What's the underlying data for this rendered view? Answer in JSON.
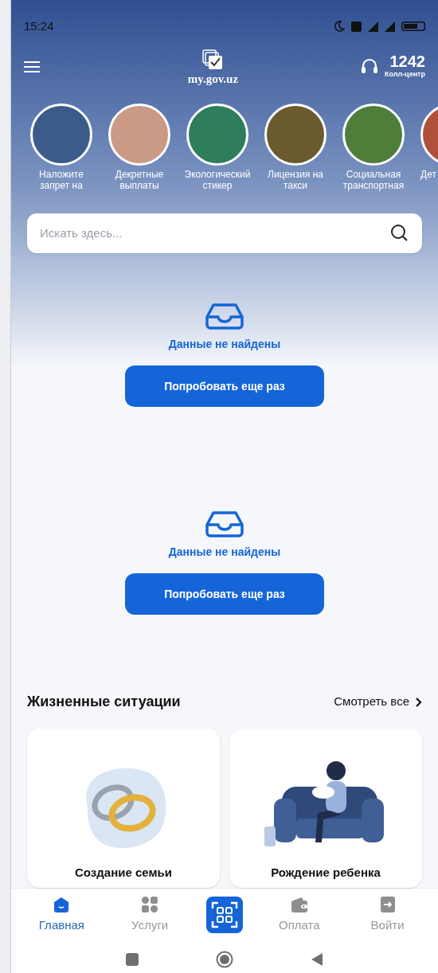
{
  "status_bar": {
    "time": "15:24"
  },
  "header": {
    "logo_text": "my.gov.uz",
    "call_center_number": "1242",
    "call_center_label": "Колл-центр"
  },
  "stories": [
    {
      "label": "Наложите запрет на"
    },
    {
      "label": "Декретные выплаты"
    },
    {
      "label": "Экологический стикер"
    },
    {
      "label": "Лицензия на такси"
    },
    {
      "label": "Социальная транспортная"
    },
    {
      "label": "Дет"
    }
  ],
  "search": {
    "placeholder": "Искать здесь..."
  },
  "empty_states": [
    {
      "message": "Данные не найдены",
      "button": "Попробовать еще раз"
    },
    {
      "message": "Данные не найдены",
      "button": "Попробовать еще раз"
    }
  ],
  "life_situations": {
    "title": "Жизненные ситуации",
    "see_all": "Смотреть все",
    "cards": [
      {
        "kind": "rings",
        "label": "Создание семьи"
      },
      {
        "kind": "mother",
        "label": "Рождение ребенка"
      }
    ]
  },
  "bottom_nav": [
    {
      "kind": "home",
      "label": "Главная",
      "selected": true
    },
    {
      "kind": "services",
      "label": "Услуги",
      "selected": false
    },
    {
      "kind": "qr",
      "selected": false
    },
    {
      "kind": "payment",
      "label": "Оплата",
      "selected": false
    },
    {
      "kind": "login",
      "label": "Войти",
      "selected": false
    }
  ]
}
